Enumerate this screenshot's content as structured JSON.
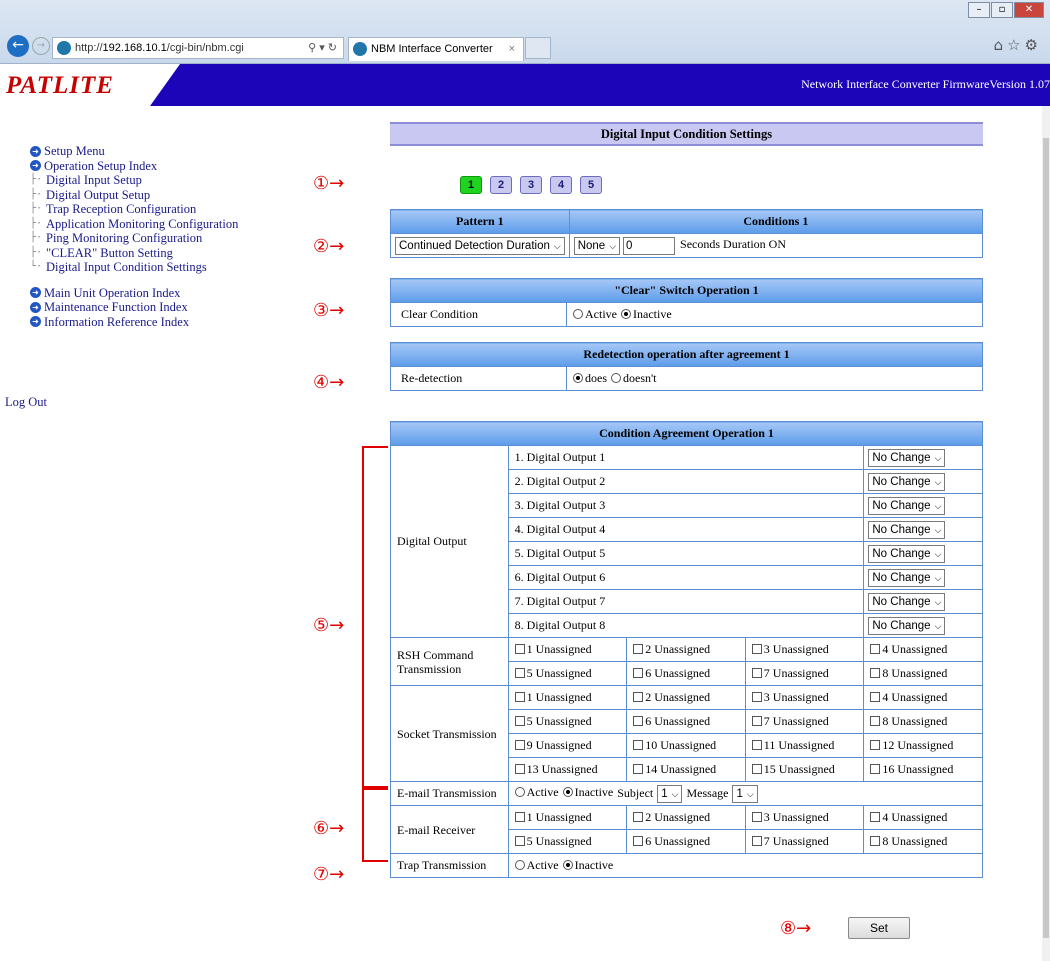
{
  "browser": {
    "url_prefix": "http://",
    "url_host": "192.168.10.1",
    "url_path": "/cgi-bin/nbm.cgi",
    "url_controls": "⚲ ▾ ↻",
    "tab_title": "NBM Interface Converter",
    "tab_close": "×",
    "win_min": "–",
    "win_max": "▫",
    "win_close": "✕",
    "tools": "⌂☆⚙"
  },
  "header": {
    "logo": "PATLITE",
    "info": "Network Interface Converter  FirmwareVersion 1.07"
  },
  "sidebar": {
    "setup_menu": "Setup Menu",
    "operation_index": "Operation Setup Index",
    "sub_items": [
      "Digital Input Setup",
      "Digital Output Setup",
      "Trap Reception Configuration",
      "Application Monitoring Configuration",
      "Ping Monitoring Configuration",
      "\"CLEAR\" Button Setting",
      "Digital Input Condition Settings"
    ],
    "main_unit_index": "Main Unit Operation Index",
    "maintenance_index": "Maintenance Function Index",
    "info_index": "Information Reference Index",
    "logout": "Log Out"
  },
  "markers": [
    "①→",
    "②→",
    "③→",
    "④→",
    "⑤→",
    "⑥→",
    "⑦→",
    "⑧→"
  ],
  "page": {
    "title": "Digital Input Condition Settings",
    "pages": [
      "1",
      "2",
      "3",
      "4",
      "5"
    ],
    "active_page": "1"
  },
  "pattern": {
    "header_pattern": "Pattern 1",
    "header_conditions": "Conditions 1",
    "pattern_select": "Continued Detection Duration",
    "cond_select": "None",
    "cond_value": "0",
    "cond_suffix": "Seconds Duration ON"
  },
  "clear_switch": {
    "header": "\"Clear\" Switch Operation 1",
    "label": "Clear Condition",
    "opt_active": "Active",
    "opt_inactive": "Inactive"
  },
  "redetect": {
    "header": "Redetection operation after agreement 1",
    "label": "Re-detection",
    "opt_does": "does",
    "opt_doesnt": "doesn't"
  },
  "agreement": {
    "header": "Condition Agreement Operation 1",
    "digital_output_label": "Digital Output",
    "outputs": [
      "1. Digital Output 1",
      "2. Digital Output 2",
      "3. Digital Output 3",
      "4. Digital Output 4",
      "5. Digital Output 5",
      "6. Digital Output 6",
      "7. Digital Output 7",
      "8. Digital Output 8"
    ],
    "output_value": "No Change",
    "rsh_label": "RSH Command Transmission",
    "rsh_items": [
      "1 Unassigned",
      "2 Unassigned",
      "3 Unassigned",
      "4 Unassigned",
      "5 Unassigned",
      "6 Unassigned",
      "7 Unassigned",
      "8 Unassigned"
    ],
    "socket_label": "Socket Transmission",
    "socket_items": [
      "1 Unassigned",
      "2 Unassigned",
      "3 Unassigned",
      "4 Unassigned",
      "5 Unassigned",
      "6 Unassigned",
      "7 Unassigned",
      "8 Unassigned",
      "9 Unassigned",
      "10 Unassigned",
      "11 Unassigned",
      "12 Unassigned",
      "13 Unassigned",
      "14 Unassigned",
      "15 Unassigned",
      "16 Unassigned"
    ],
    "email_label": "E-mail Transmission",
    "email_active": "Active",
    "email_inactive": "Inactive",
    "subject_label": "Subject",
    "subject_value": "1",
    "message_label": "Message",
    "message_value": "1",
    "receiver_label": "E-mail Receiver",
    "receiver_items": [
      "1 Unassigned",
      "2 Unassigned",
      "3 Unassigned",
      "4 Unassigned",
      "5 Unassigned",
      "6 Unassigned",
      "7 Unassigned",
      "8 Unassigned"
    ],
    "trap_label": "Trap Transmission",
    "trap_active": "Active",
    "trap_inactive": "Inactive"
  },
  "set_button": "Set"
}
